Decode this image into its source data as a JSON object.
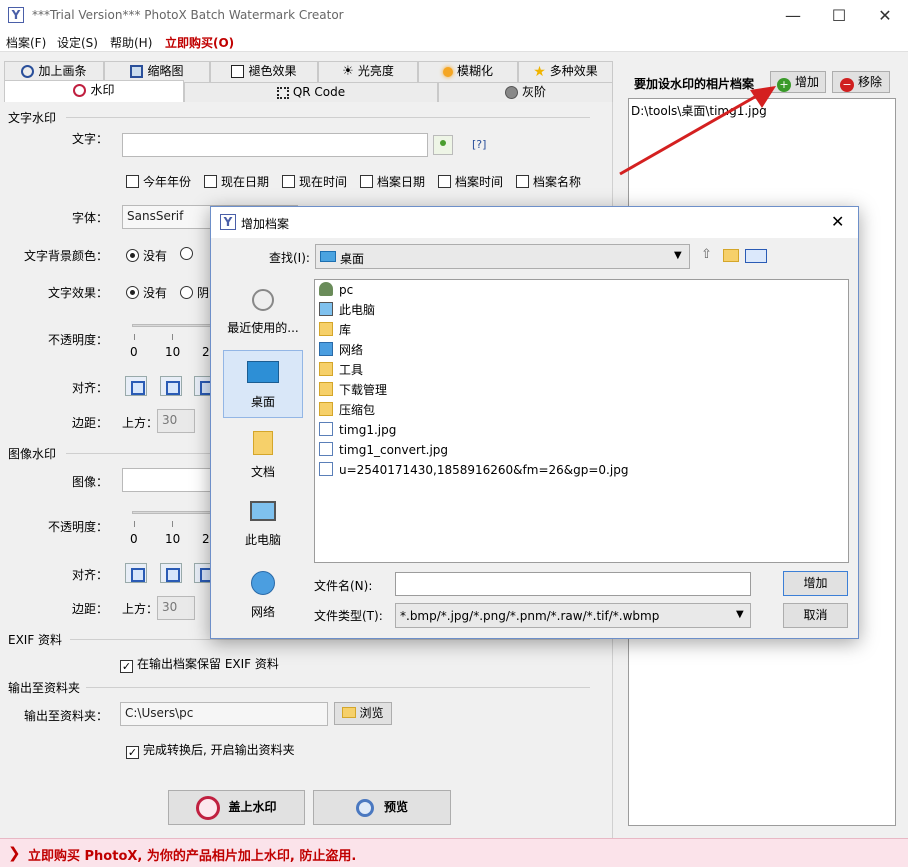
{
  "window": {
    "title": "***Trial Version*** PhotoX Batch Watermark Creator",
    "app_icon": "Y",
    "minimize": "—",
    "maximize": "☐",
    "close": "✕"
  },
  "menu": {
    "file": "档案(F)",
    "settings": "设定(S)",
    "help": "帮助(H)",
    "buy": "立即购买(O)"
  },
  "tabs_row1": [
    {
      "label": "加上画条",
      "icon": "frame-icon"
    },
    {
      "label": "缩略图",
      "icon": "thumbnail-icon"
    },
    {
      "label": "褪色效果",
      "icon": "fade-icon"
    },
    {
      "label": "光亮度",
      "icon": "brightness-icon"
    },
    {
      "label": "模糊化",
      "icon": "blur-icon"
    },
    {
      "label": "多种效果",
      "icon": "star-icon"
    }
  ],
  "tabs_row2": [
    {
      "label": "水印",
      "icon": "watermark-icon"
    },
    {
      "label": "QR Code",
      "icon": "qr-icon"
    },
    {
      "label": "灰阶",
      "icon": "grayscale-icon"
    }
  ],
  "text_watermark": {
    "section": "文字水印",
    "text_label": "文字：",
    "text_value": "",
    "help_link": "[?]",
    "checkboxes": [
      "今年年份",
      "现在日期",
      "现在时间",
      "档案日期",
      "档案时间",
      "档案名称"
    ],
    "font_label": "字体：",
    "font_value": "SansSerif",
    "bg_color_label": "文字背景颜色：",
    "bg_none": "没有",
    "effect_label": "文字效果：",
    "effect_none": "没有",
    "effect_shadow": "阴",
    "opacity_label": "不透明度：",
    "opacity_ticks": [
      "0",
      "10",
      "2"
    ],
    "align_label": "对齐：",
    "margin_label": "边距：",
    "top_label": "上方：",
    "top_value": "30"
  },
  "image_watermark": {
    "section": "图像水印",
    "image_label": "图像：",
    "image_value": "",
    "opacity_label": "不透明度：",
    "opacity_ticks": [
      "0",
      "10",
      "2"
    ],
    "align_label": "对齐：",
    "margin_label": "边距：",
    "top_label": "上方：",
    "top_value": "30"
  },
  "exif": {
    "section": "EXIF 资料",
    "keep_label": "在输出档案保留 EXIF 资料",
    "keep_checked": "✓"
  },
  "output": {
    "section": "输出至资料夹",
    "label": "输出至资料夹：",
    "value": "C:\\Users\\pc",
    "browse": "浏览",
    "open_after_label": "完成转换后, 开启输出资料夹",
    "open_after_checked": "✓"
  },
  "actions": {
    "apply": "盖上水印",
    "preview": "预览"
  },
  "right": {
    "title": "要加设水印的相片档案",
    "add": "增加",
    "remove": "移除",
    "files": [
      "D:\\tools\\桌面\\timg1.jpg"
    ]
  },
  "status": {
    "chevron": "❯",
    "text": "立即购买 PhotoX, 为你的产品相片加上水印, 防止盗用."
  },
  "dialog": {
    "title": "增加档案",
    "lookin_label": "查找(I):",
    "lookin_value": "桌面",
    "places": [
      "最近使用的...",
      "桌面",
      "文档",
      "此电脑",
      "网络"
    ],
    "files": [
      {
        "name": "pc",
        "type": "user"
      },
      {
        "name": "此电脑",
        "type": "computer"
      },
      {
        "name": "库",
        "type": "library"
      },
      {
        "name": "网络",
        "type": "network"
      },
      {
        "name": "工具",
        "type": "folder"
      },
      {
        "name": "下载管理",
        "type": "folder"
      },
      {
        "name": "压缩包",
        "type": "folder"
      },
      {
        "name": "timg1.jpg",
        "type": "image"
      },
      {
        "name": "timg1_convert.jpg",
        "type": "image"
      },
      {
        "name": "u=2540171430,1858916260&fm=26&gp=0.jpg",
        "type": "image"
      }
    ],
    "filename_label": "文件名(N):",
    "filename_value": "",
    "filetype_label": "文件类型(T):",
    "filetype_value": "*.bmp/*.jpg/*.png/*.pnm/*.raw/*.tif/*.wbmp",
    "add_button": "增加",
    "cancel_button": "取消",
    "close": "✕"
  },
  "colors": {
    "buy_red": "#c00000",
    "status_bg": "#fbe3ea",
    "selection_blue": "#d9e7f8",
    "arrow_red": "#d42020"
  }
}
